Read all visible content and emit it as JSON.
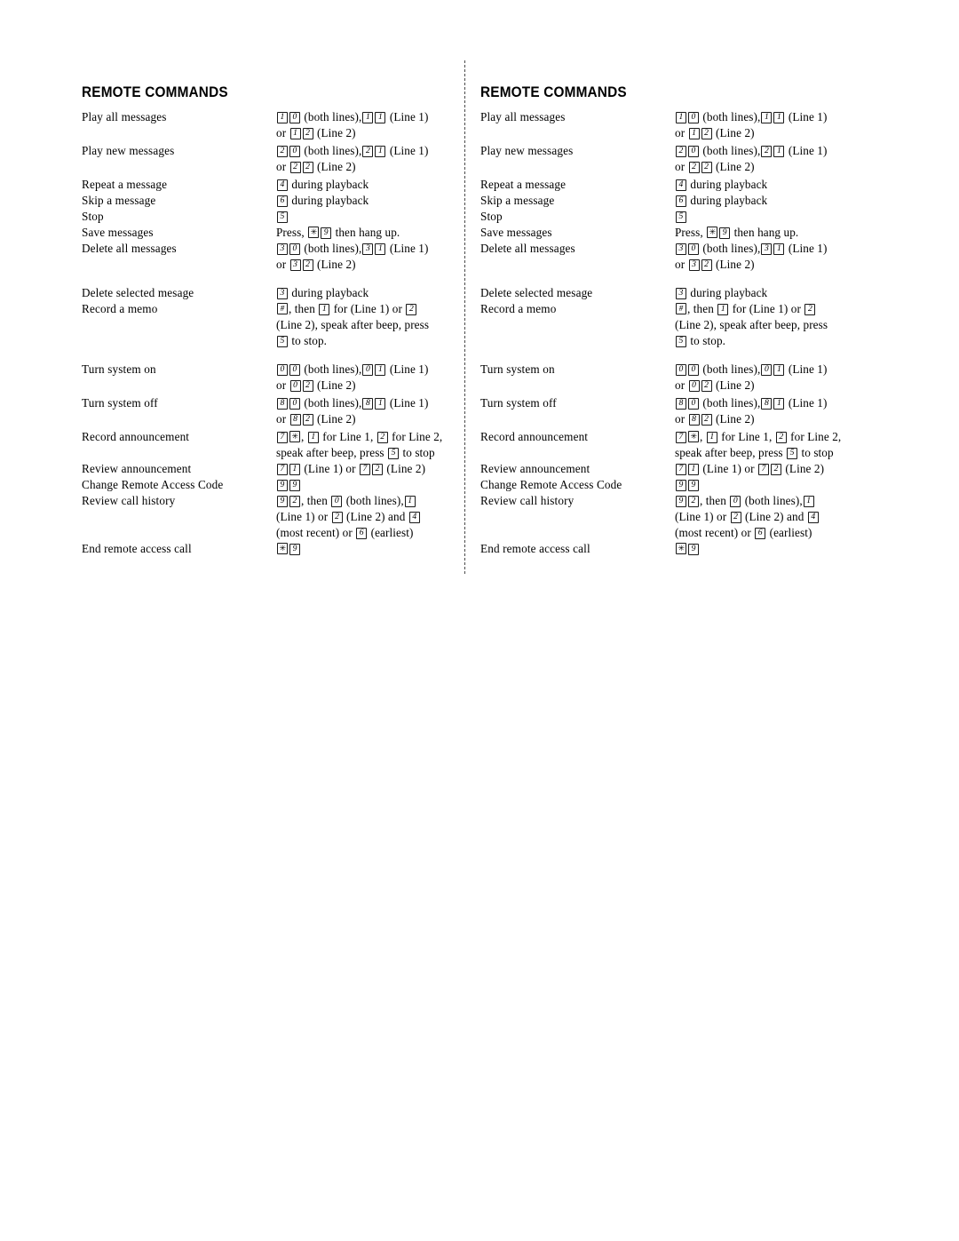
{
  "document": {
    "title": "REMOTE COMMANDS",
    "background_color": "#ffffff",
    "text_color": "#000000",
    "cut_line_color": "#4a4a4a"
  },
  "card": {
    "heading": "REMOTE COMMANDS",
    "commands": [
      {
        "label": "Play all messages",
        "value_lines": [
          [
            {
              "t": "key",
              "v": "1"
            },
            {
              "t": "key",
              "v": "0"
            },
            {
              "t": "txt",
              "v": " (both lines),"
            },
            {
              "t": "key",
              "v": "1"
            },
            {
              "t": "key",
              "v": "1"
            },
            {
              "t": "txt",
              "v": " (Line 1)"
            }
          ],
          [
            {
              "t": "txt",
              "v": "or "
            },
            {
              "t": "key",
              "v": "1"
            },
            {
              "t": "key",
              "v": "2"
            },
            {
              "t": "txt",
              "v": " (Line 2)"
            }
          ]
        ],
        "value_text": "1 0 (both lines), 1 1 (Line 1) or 1 2 (Line 2)",
        "spacing": "gap-small"
      },
      {
        "label": "Play new messages",
        "value_lines": [
          [
            {
              "t": "key",
              "v": "2"
            },
            {
              "t": "key",
              "v": "0"
            },
            {
              "t": "txt",
              "v": " (both lines),"
            },
            {
              "t": "key",
              "v": "2"
            },
            {
              "t": "key",
              "v": "1"
            },
            {
              "t": "txt",
              "v": " (Line 1)"
            }
          ],
          [
            {
              "t": "txt",
              "v": "or "
            },
            {
              "t": "key",
              "v": "2"
            },
            {
              "t": "key",
              "v": "2"
            },
            {
              "t": "txt",
              "v": " (Line 2)"
            }
          ]
        ],
        "value_text": "2 0 (both lines), 2 1 (Line 1) or 2 2 (Line 2)",
        "spacing": "gap-small"
      },
      {
        "label": "Repeat a message",
        "value_lines": [
          [
            {
              "t": "key",
              "v": "4"
            },
            {
              "t": "txt",
              "v": " during playback"
            }
          ]
        ],
        "value_text": "4 during playback",
        "spacing": ""
      },
      {
        "label": "Skip a message",
        "value_lines": [
          [
            {
              "t": "key",
              "v": "6"
            },
            {
              "t": "txt",
              "v": " during playback"
            }
          ]
        ],
        "value_text": "6 during playback",
        "spacing": ""
      },
      {
        "label": "Stop",
        "value_lines": [
          [
            {
              "t": "key",
              "v": "5"
            }
          ]
        ],
        "value_text": "5",
        "spacing": ""
      },
      {
        "label": "Save messages",
        "value_lines": [
          [
            {
              "t": "txt",
              "v": "Press, "
            },
            {
              "t": "star",
              "v": "✳"
            },
            {
              "t": "key",
              "v": "9"
            },
            {
              "t": "txt",
              "v": " then hang up."
            }
          ]
        ],
        "value_text": "Press, * 9 then hang up.",
        "spacing": ""
      },
      {
        "label": "Delete all messages",
        "value_lines": [
          [
            {
              "t": "key",
              "v": "3"
            },
            {
              "t": "key",
              "v": "0"
            },
            {
              "t": "txt",
              "v": " (both lines),"
            },
            {
              "t": "key",
              "v": "3"
            },
            {
              "t": "key",
              "v": "1"
            },
            {
              "t": "txt",
              "v": " (Line 1)"
            }
          ],
          [
            {
              "t": "txt",
              "v": "or "
            },
            {
              "t": "key",
              "v": "3"
            },
            {
              "t": "key",
              "v": "2"
            },
            {
              "t": "txt",
              "v": " (Line 2)"
            }
          ]
        ],
        "value_text": "3 0 (both lines), 3 1 (Line 1) or 3 2 (Line 2)",
        "spacing": "gap-after"
      },
      {
        "label": "Delete selected mesage",
        "value_lines": [
          [
            {
              "t": "key",
              "v": "3"
            },
            {
              "t": "txt",
              "v": " during playback"
            }
          ]
        ],
        "value_text": "3 during playback",
        "spacing": ""
      },
      {
        "label": "Record a memo",
        "value_lines": [
          [
            {
              "t": "hash",
              "v": "#"
            },
            {
              "t": "txt",
              "v": ", then "
            },
            {
              "t": "key",
              "v": "1"
            },
            {
              "t": "txt",
              "v": " for (Line 1) or "
            },
            {
              "t": "key",
              "v": "2"
            }
          ],
          [
            {
              "t": "txt",
              "v": "(Line 2), speak after beep, press"
            }
          ],
          [
            {
              "t": "key",
              "v": "5"
            },
            {
              "t": "txt",
              "v": " to stop."
            }
          ]
        ],
        "value_text": "#, then 1 for (Line 1) or 2 (Line 2), speak after beep, press 5 to stop.",
        "spacing": "gap-after"
      },
      {
        "label": "Turn system on",
        "value_lines": [
          [
            {
              "t": "key",
              "v": "0"
            },
            {
              "t": "key",
              "v": "0"
            },
            {
              "t": "txt",
              "v": " (both lines),"
            },
            {
              "t": "key",
              "v": "0"
            },
            {
              "t": "key",
              "v": "1"
            },
            {
              "t": "txt",
              "v": " (Line 1)"
            }
          ],
          [
            {
              "t": "txt",
              "v": "or "
            },
            {
              "t": "key",
              "v": "0"
            },
            {
              "t": "key",
              "v": "2"
            },
            {
              "t": "txt",
              "v": " (Line 2)"
            }
          ]
        ],
        "value_text": "0 0 (both lines), 0 1 (Line 1) or 0 2 (Line 2)",
        "spacing": "gap-small"
      },
      {
        "label": "Turn system off",
        "value_lines": [
          [
            {
              "t": "key",
              "v": "8"
            },
            {
              "t": "key",
              "v": "0"
            },
            {
              "t": "txt",
              "v": " (both lines),"
            },
            {
              "t": "key",
              "v": "8"
            },
            {
              "t": "key",
              "v": "1"
            },
            {
              "t": "txt",
              "v": " (Line 1)"
            }
          ],
          [
            {
              "t": "txt",
              "v": "or "
            },
            {
              "t": "key",
              "v": "8"
            },
            {
              "t": "key",
              "v": "2"
            },
            {
              "t": "txt",
              "v": " (Line 2)"
            }
          ]
        ],
        "value_text": "8 0 (both lines), 8 1 (Line 1) or 8 2 (Line 2)",
        "spacing": "gap-small"
      },
      {
        "label": "Record announcement",
        "value_lines": [
          [
            {
              "t": "key",
              "v": "7"
            },
            {
              "t": "star",
              "v": "✳"
            },
            {
              "t": "txt",
              "v": ", "
            },
            {
              "t": "key",
              "v": "1"
            },
            {
              "t": "txt",
              "v": " for Line 1, "
            },
            {
              "t": "key",
              "v": "2"
            },
            {
              "t": "txt",
              "v": " for Line 2,"
            }
          ],
          [
            {
              "t": "txt",
              "v": "speak after beep, press "
            },
            {
              "t": "key",
              "v": "5"
            },
            {
              "t": "txt",
              "v": " to stop"
            }
          ]
        ],
        "value_text": "7 *, 1 for Line 1, 2 for Line 2, speak after beep, press 5 to stop",
        "spacing": ""
      },
      {
        "label": "Review announcement",
        "value_lines": [
          [
            {
              "t": "key",
              "v": "7"
            },
            {
              "t": "key",
              "v": "1"
            },
            {
              "t": "txt",
              "v": " (Line 1) or "
            },
            {
              "t": "key",
              "v": "7"
            },
            {
              "t": "key",
              "v": "2"
            },
            {
              "t": "txt",
              "v": " (Line 2)"
            }
          ]
        ],
        "value_text": "7 1 (Line 1) or 7 2 (Line 2)",
        "spacing": ""
      },
      {
        "label": "Change Remote Access Code",
        "value_lines": [
          [
            {
              "t": "key",
              "v": "9"
            },
            {
              "t": "key",
              "v": "9"
            }
          ]
        ],
        "value_text": "9 9",
        "spacing": ""
      },
      {
        "label": "Review call history",
        "value_lines": [
          [
            {
              "t": "key",
              "v": "9"
            },
            {
              "t": "key",
              "v": "2"
            },
            {
              "t": "txt",
              "v": ", then "
            },
            {
              "t": "key",
              "v": "0"
            },
            {
              "t": "txt",
              "v": " (both lines),"
            },
            {
              "t": "key",
              "v": "1"
            }
          ],
          [
            {
              "t": "txt",
              "v": "(Line 1) or "
            },
            {
              "t": "key",
              "v": "2"
            },
            {
              "t": "txt",
              "v": " (Line 2) and "
            },
            {
              "t": "key",
              "v": "4"
            }
          ],
          [
            {
              "t": "txt",
              "v": "(most recent) or "
            },
            {
              "t": "key",
              "v": "6"
            },
            {
              "t": "txt",
              "v": " (earliest)"
            }
          ]
        ],
        "value_text": "9 2, then 0 (both lines), 1 (Line 1) or 2 (Line 2) and 4 (most recent) or 6 (earliest)",
        "spacing": ""
      },
      {
        "label": "End remote access call",
        "value_lines": [
          [
            {
              "t": "star",
              "v": "✳"
            },
            {
              "t": "key",
              "v": "9"
            }
          ]
        ],
        "value_text": "* 9",
        "spacing": ""
      }
    ]
  }
}
